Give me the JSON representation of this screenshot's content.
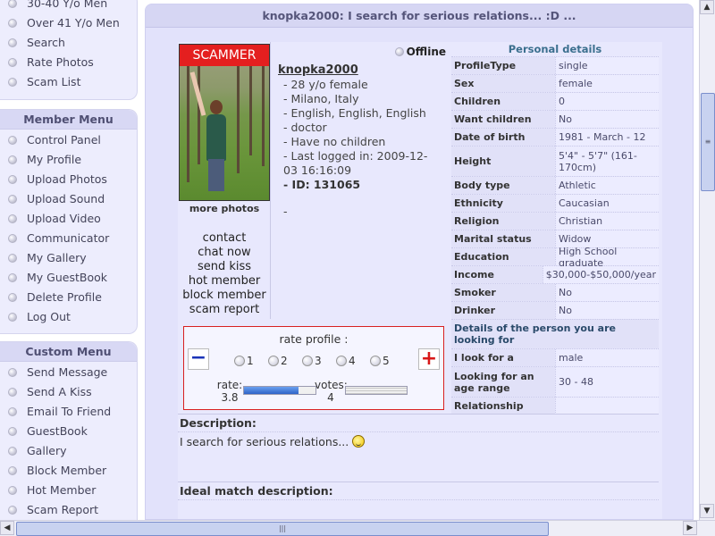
{
  "sidebar": {
    "top_items": [
      "30-40 Y/o Men",
      "Over 41 Y/o Men",
      "Search",
      "Rate Photos",
      "Scam List"
    ],
    "member_menu": {
      "title": "Member Menu",
      "items": [
        "Control Panel",
        "My Profile",
        "Upload Photos",
        "Upload Sound",
        "Upload Video",
        "Communicator",
        "My Gallery",
        "My GuestBook",
        "Delete Profile",
        "Log Out"
      ]
    },
    "custom_menu": {
      "title": "Custom Menu",
      "items": [
        "Send Message",
        "Send A Kiss",
        "Email To Friend",
        "GuestBook",
        "Gallery",
        "Block Member",
        "Hot Member",
        "Scam Report"
      ]
    }
  },
  "profile": {
    "title": "knopka2000: I search for serious relations... :D ...",
    "scammer_badge": "SCAMMER",
    "status": "Offline",
    "username": "knopka2000",
    "age_gender": "- 28 y/o female",
    "location": "- Milano, Italy",
    "languages": "- English, English, English",
    "occupation": "- doctor",
    "children": "- Have no children",
    "last_login": "- Last logged in: 2009-12-03 16:16:09",
    "id_label": "- ID: 131065",
    "dash": "-",
    "more_photos": "more photos",
    "actions": [
      "contact",
      "chat now",
      "send kiss",
      "hot member",
      "block member",
      "scam report"
    ]
  },
  "rating": {
    "label": "rate profile :",
    "options": [
      "1",
      "2",
      "3",
      "4",
      "5"
    ],
    "rate_label": "rate:",
    "rate_value": "3.8",
    "rate_fraction": 0.76,
    "votes_label": "votes:",
    "votes_value": "4",
    "minus_symbol": "−",
    "plus_symbol": "+"
  },
  "details": {
    "title": "Personal details",
    "rows": [
      {
        "label": "ProfileType",
        "value": "single"
      },
      {
        "label": "Sex",
        "value": "female"
      },
      {
        "label": "Children",
        "value": "0"
      },
      {
        "label": "Want children",
        "value": "No"
      },
      {
        "label": "Date of birth",
        "value": "1981 - March - 12"
      },
      {
        "label": "Height",
        "value": "5'4\" - 5'7\" (161-170cm)"
      },
      {
        "label": "Body type",
        "value": "Athletic"
      },
      {
        "label": "Ethnicity",
        "value": "Caucasian"
      },
      {
        "label": "Religion",
        "value": "Christian"
      },
      {
        "label": "Marital status",
        "value": "Widow"
      },
      {
        "label": "Education",
        "value": "High School graduate"
      },
      {
        "label": "Income",
        "value": "$30,000-$50,000/year"
      },
      {
        "label": "Smoker",
        "value": "No"
      },
      {
        "label": "Drinker",
        "value": "No"
      }
    ],
    "looking_title": "Details of the person you are looking for",
    "looking_rows": [
      {
        "label": "I look for a",
        "value": "male"
      },
      {
        "label": "Looking for an age range",
        "value": "30 -  48"
      },
      {
        "label": "Relationship",
        "value": ""
      }
    ]
  },
  "description": {
    "title": "Description:",
    "text": "I search for serious relations..."
  },
  "ideal_match": {
    "title": "Ideal match description:"
  },
  "colors": {
    "scammer_red": "#e41f1f",
    "panel_bg": "#ededfd",
    "main_bg": "#e2e2fb",
    "header_text": "#4f4f73"
  }
}
